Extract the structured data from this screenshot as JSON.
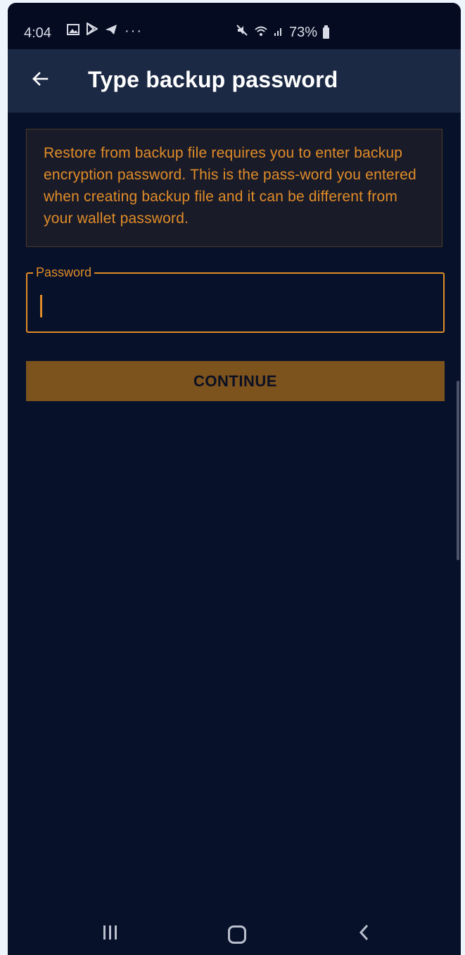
{
  "status_bar": {
    "time": "4:04",
    "battery": "73%",
    "left_icons": [
      "gallery-icon",
      "play-store-icon",
      "telegram-icon",
      "more-icon"
    ],
    "right_icons": [
      "mute-icon",
      "wifi-icon",
      "signal-icon",
      "battery-icon"
    ]
  },
  "app_bar": {
    "title": "Type backup password",
    "back_icon": "back-arrow-icon"
  },
  "info": {
    "text": "Restore from backup file requires you to enter backup encryption password. This is the pass-word you entered when creating backup file and it can be different from your wallet password."
  },
  "password_field": {
    "label": "Password",
    "value": ""
  },
  "continue_button": {
    "label": "CONTINUE"
  },
  "nav_bar": {
    "icons": [
      "recents-icon",
      "home-icon",
      "back-icon"
    ]
  },
  "colors": {
    "background": "#08112a",
    "app_bar": "#1c2944",
    "accent": "#e08c28",
    "button": "#7c521d"
  }
}
